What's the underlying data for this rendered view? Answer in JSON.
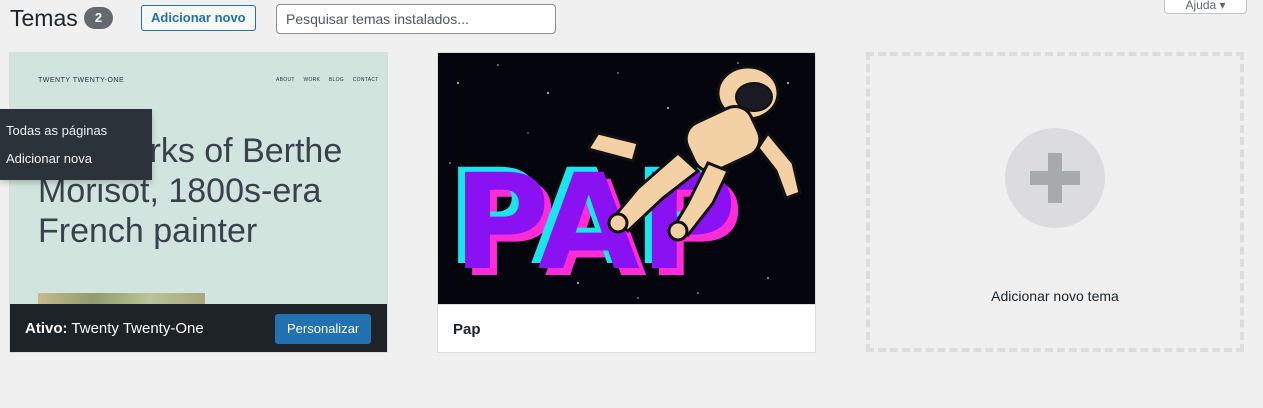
{
  "header": {
    "title": "Temas",
    "count": "2",
    "add_new_label": "Adicionar novo",
    "search_placeholder": "Pesquisar temas instalados...",
    "search_value": "",
    "help_label": "Ajuda ▾"
  },
  "menu_flyout": {
    "items": [
      {
        "label": "Todas as páginas"
      },
      {
        "label": "Adicionar nova"
      }
    ]
  },
  "themes": [
    {
      "name": "Twenty Twenty-One",
      "active": true,
      "active_prefix": "Ativo:",
      "customize_label": "Personalizar",
      "preview": {
        "site_title": "TWENTY TWENTY-ONE",
        "nav": [
          "ABOUT",
          "WORK",
          "BLOG",
          "CONTACT"
        ],
        "headline": "The works of Berthe Morisot, 1800s-era French painter",
        "background": "#d1e4dd"
      }
    },
    {
      "name": "Pap",
      "active": false,
      "preview": {
        "logo_text": "PAP",
        "background": "#05060d"
      }
    }
  ],
  "add_new_theme": {
    "label": "Adicionar novo tema"
  },
  "colors": {
    "accent": "#2271b1",
    "admin_dark": "#1d2327",
    "flyout_bg": "#2c3338",
    "pap_purple": "#8a12f2",
    "pap_pink": "#ff2bd6",
    "pap_cyan": "#19e5f0"
  }
}
